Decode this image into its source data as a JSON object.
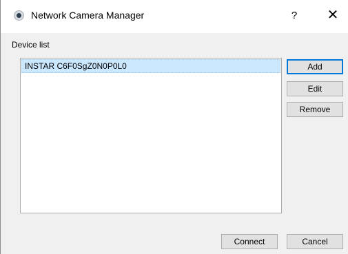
{
  "window": {
    "title": "Network Camera Manager",
    "help_label": "?",
    "close_label": "✕",
    "app_icon": "camera-lens-icon"
  },
  "device_list": {
    "label": "Device list",
    "items": [
      {
        "name": "INSTAR C6F0SgZ0N0P0L0",
        "selected": true
      }
    ]
  },
  "side_buttons": {
    "add": "Add",
    "edit": "Edit",
    "remove": "Remove"
  },
  "footer_buttons": {
    "connect": "Connect",
    "cancel": "Cancel"
  },
  "colors": {
    "selection_background": "#cce8ff",
    "default_button_border": "#0078d7",
    "window_background": "#f0f0f0"
  }
}
